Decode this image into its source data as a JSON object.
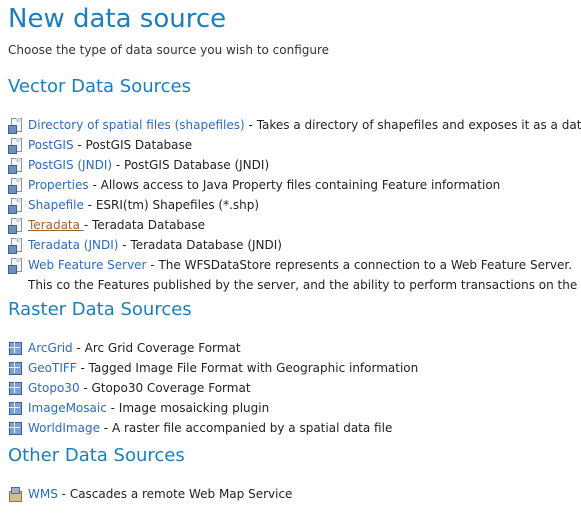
{
  "page": {
    "title": "New data source",
    "subtitle": "Choose the type of data source you wish to configure"
  },
  "vector": {
    "heading": "Vector Data Sources",
    "items": [
      {
        "link": "Directory of spatial files (shapefiles)",
        "sep": " - ",
        "desc": "Takes a directory of shapefiles and exposes it as a data store",
        "icon": "vector-source-icon"
      },
      {
        "link": "PostGIS",
        "sep": " - ",
        "desc": "PostGIS Database",
        "icon": "vector-source-icon"
      },
      {
        "link": "PostGIS (JNDI)",
        "sep": " - ",
        "desc": "PostGIS Database (JNDI)",
        "icon": "vector-source-icon"
      },
      {
        "link": "Properties",
        "sep": " - ",
        "desc": "Allows access to Java Property files containing Feature information",
        "icon": "vector-source-icon"
      },
      {
        "link": "Shapefile",
        "sep": " - ",
        "desc": "ESRI(tm) Shapefiles (*.shp)",
        "icon": "vector-source-icon"
      },
      {
        "link": "Teradata ",
        "sep": " - ",
        "desc": "Teradata Database",
        "icon": "vector-source-icon"
      },
      {
        "link": "Teradata (JNDI)",
        "sep": " - ",
        "desc": "Teradata Database (JNDI)",
        "icon": "vector-source-icon"
      },
      {
        "link": "Web Feature Server",
        "sep": " - ",
        "desc": "The WFSDataStore represents a connection to a Web Feature Server. This co the Features published by the server, and the ability to perform transactions on the server (when suppo",
        "icon": "vector-source-icon"
      }
    ]
  },
  "raster": {
    "heading": "Raster Data Sources",
    "items": [
      {
        "link": "ArcGrid",
        "sep": " - ",
        "desc": "Arc Grid Coverage Format",
        "icon": "raster-source-icon"
      },
      {
        "link": "GeoTIFF",
        "sep": " - ",
        "desc": "Tagged Image File Format with Geographic information",
        "icon": "raster-source-icon"
      },
      {
        "link": "Gtopo30",
        "sep": " - ",
        "desc": "Gtopo30 Coverage Format",
        "icon": "raster-source-icon"
      },
      {
        "link": "ImageMosaic",
        "sep": " - ",
        "desc": "Image mosaicking plugin",
        "icon": "raster-source-icon"
      },
      {
        "link": "WorldImage",
        "sep": " - ",
        "desc": "A raster file accompanied by a spatial data file",
        "icon": "raster-source-icon"
      }
    ]
  },
  "other": {
    "heading": "Other Data Sources",
    "items": [
      {
        "link": "WMS",
        "sep": " - ",
        "desc": "Cascades a remote Web Map Service",
        "icon": "wms-source-icon"
      }
    ]
  },
  "colors": {
    "heading": "#1a7fc0",
    "link": "#2a6bc2",
    "hovered_link": "#a0622a"
  }
}
